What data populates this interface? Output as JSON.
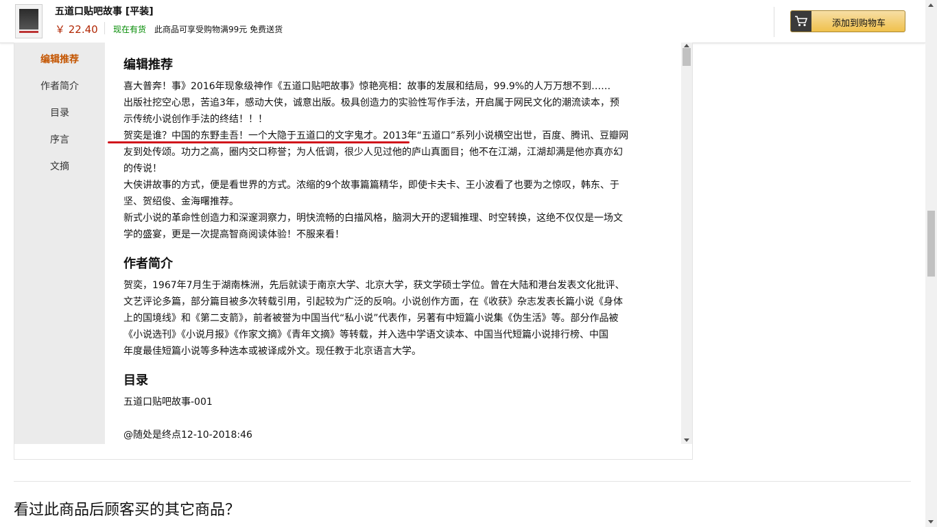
{
  "header": {
    "product_title": "五道口贴吧故事 [平装]",
    "price": "￥ 22.40",
    "stock_status": "现在有货",
    "shipping_note": "此商品可享受购物满99元 免费送货",
    "cart_button_label": "添加到购物车",
    "cart_icon": "shopping-cart-icon"
  },
  "sidebar": {
    "items": [
      {
        "label": "编辑推荐",
        "active": true
      },
      {
        "label": "作者简介",
        "active": false
      },
      {
        "label": "目录",
        "active": false
      },
      {
        "label": "序言",
        "active": false
      },
      {
        "label": "文摘",
        "active": false
      }
    ]
  },
  "sections": {
    "editor": {
      "title": "编辑推荐",
      "lines": [
        "喜大普奔！事》2016年现象级神作《五道口贴吧故事》惊艳亮相：故事的发展和结局，99.9%的人万万想不到……",
        "出版社挖空心思，苦追3年，感动大侠，诚意出版。极具创造力的实验性写作手法，开启属于网民文化的潮流读本，预",
        "示传统小说创作手法的终结！！！",
        "贺奕是谁？中国的东野圭吾！一个大隐于五道口的文字鬼才。2013年“五道口”系列小说横空出世，百度、腾讯、豆瓣网",
        "友到处传颂。功力之高，圈内交口称誉；为人低调，很少人见过他的庐山真面目；他不在江湖，江湖却满是他亦真亦幻",
        "的传说！",
        "大侠讲故事的方式，便是看世界的方式。浓缩的9个故事篇篇精华，即使卡夫卡、王小波看了也要为之惊叹，韩东、于",
        "坚、贺绍俊、金海曙推荐。",
        "新式小说的革命性创造力和深邃洞察力，明快流畅的白描风格，脑洞大开的逻辑推理、时空转换，这绝不仅仅是一场文",
        "学的盛宴，更是一次提高智商阅读体验！不服来看！"
      ]
    },
    "author": {
      "title": "作者简介",
      "lines": [
        "贺奕，1967年7月生于湖南株洲，先后就读于南京大学、北京大学，获文学硕士学位。曾在大陆和港台发表文化批评、",
        "文艺评论多篇，部分篇目被多次转载引用，引起较为广泛的反响。小说创作方面，在《收获》杂志发表长篇小说《身体",
        "上的国境线》和《第二支箭》，前者被誉为中国当代“私小说”代表作，另著有中短篇小说集《伪生活》等。部分作品被",
        "《小说选刊》《小说月报》《作家文摘》《青年文摘》等转载，并入选中学语文读本、中国当代短篇小说排行榜、中国",
        "年度最佳短篇小说等多种选本或被译成外文。现任教于北京语言大学。"
      ]
    },
    "toc": {
      "title": "目录",
      "lines": [
        "五道口贴吧故事-001",
        "@随处是终点12-10-2018:46"
      ]
    }
  },
  "footer": {
    "also_bought_title": "看过此商品后顾客买的其它商品？"
  },
  "colors": {
    "accent_orange": "#c45500",
    "price_red": "#b12704",
    "in_stock_green": "#008a00",
    "underline_red": "#d0101a",
    "cart_button": "#f0c14b"
  }
}
